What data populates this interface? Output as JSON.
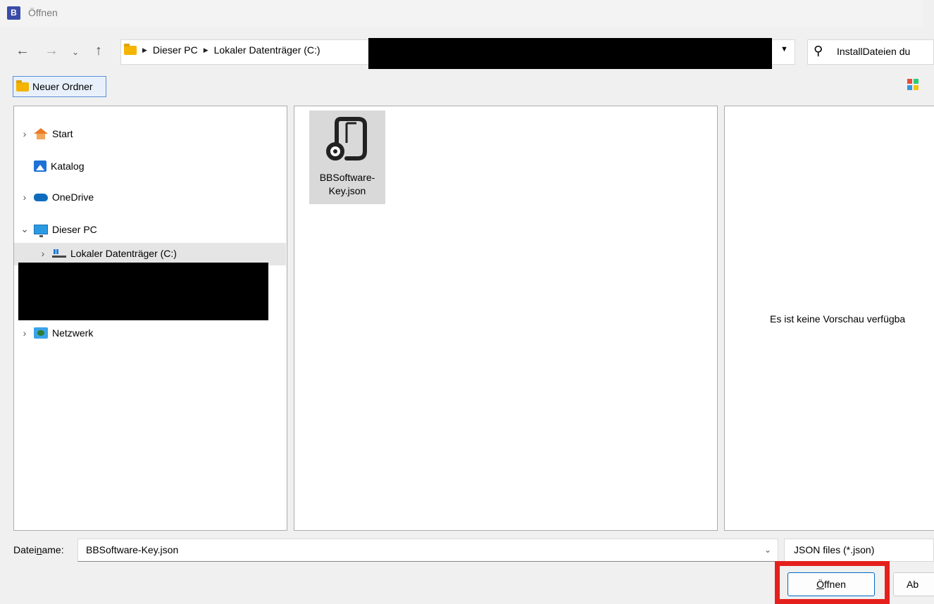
{
  "window": {
    "title": "Öffnen",
    "app_icon_letter": "B"
  },
  "nav": {
    "back": "←",
    "forward": "→",
    "recent": "⌄",
    "up": "↑",
    "breadcrumb": [
      "Dieser PC",
      "Lokaler Datenträger (C:)"
    ]
  },
  "search": {
    "placeholder": "InstallDateien du"
  },
  "toolbar": {
    "new_folder_label": "Neuer Ordner"
  },
  "sidebar": {
    "items": [
      {
        "label": "Start",
        "icon": "home-icon"
      },
      {
        "label": "Katalog",
        "icon": "gallery-icon"
      },
      {
        "label": "OneDrive",
        "icon": "cloud-icon"
      },
      {
        "label": "Dieser PC",
        "icon": "monitor-icon"
      },
      {
        "label": "Lokaler Datenträger (C:)",
        "icon": "drive-icon"
      },
      {
        "label": "Netzwerk",
        "icon": "network-icon"
      }
    ]
  },
  "files": [
    {
      "line1": "BBSoftware-",
      "line2": "Key.json",
      "icon": "json-file-icon"
    }
  ],
  "preview": {
    "text": "Es ist keine Vorschau verfügba"
  },
  "footer": {
    "filename_label_pre": "Datei",
    "filename_label_u": "n",
    "filename_label_post": "ame:",
    "filename_value": "BBSoftware-Key.json",
    "filter_value": "JSON files (*.json)",
    "open_pre": "Ö",
    "open_post": "ffnen",
    "cancel_label": "Ab"
  },
  "colors": {
    "highlight": "#e5201c",
    "accent": "#0067c0",
    "folder": "#f4b400"
  }
}
